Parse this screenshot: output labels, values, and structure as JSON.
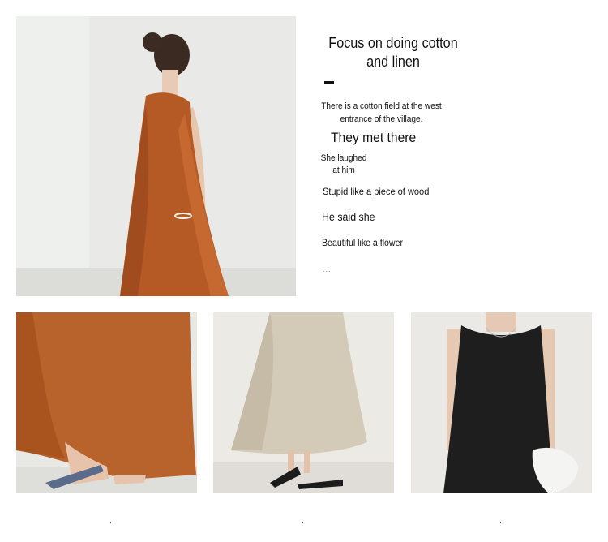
{
  "copy": {
    "title": "Focus on doing cotton and linen",
    "para1": "There is a cotton field at the west entrance of the village.",
    "heading": "They met there",
    "para2": "She laughed at him",
    "para3": "Stupid like a piece of wood",
    "para4": "He said she",
    "para5": "Beautiful like a flower",
    "ellipsis": "..."
  },
  "thumbnails": [
    {
      "caption": "."
    },
    {
      "caption": "."
    },
    {
      "caption": "."
    }
  ],
  "colors": {
    "rust": "#b45a26",
    "linen": "#d3c8b4",
    "black": "#1d1d1e",
    "wall": "#e8e9e6"
  },
  "images": {
    "main": "model-back-rust-dress-photo",
    "thumb1": "rust-dress-hem-photo",
    "thumb2": "linen-dress-hem-photo",
    "thumb3": "black-dress-front-photo"
  }
}
